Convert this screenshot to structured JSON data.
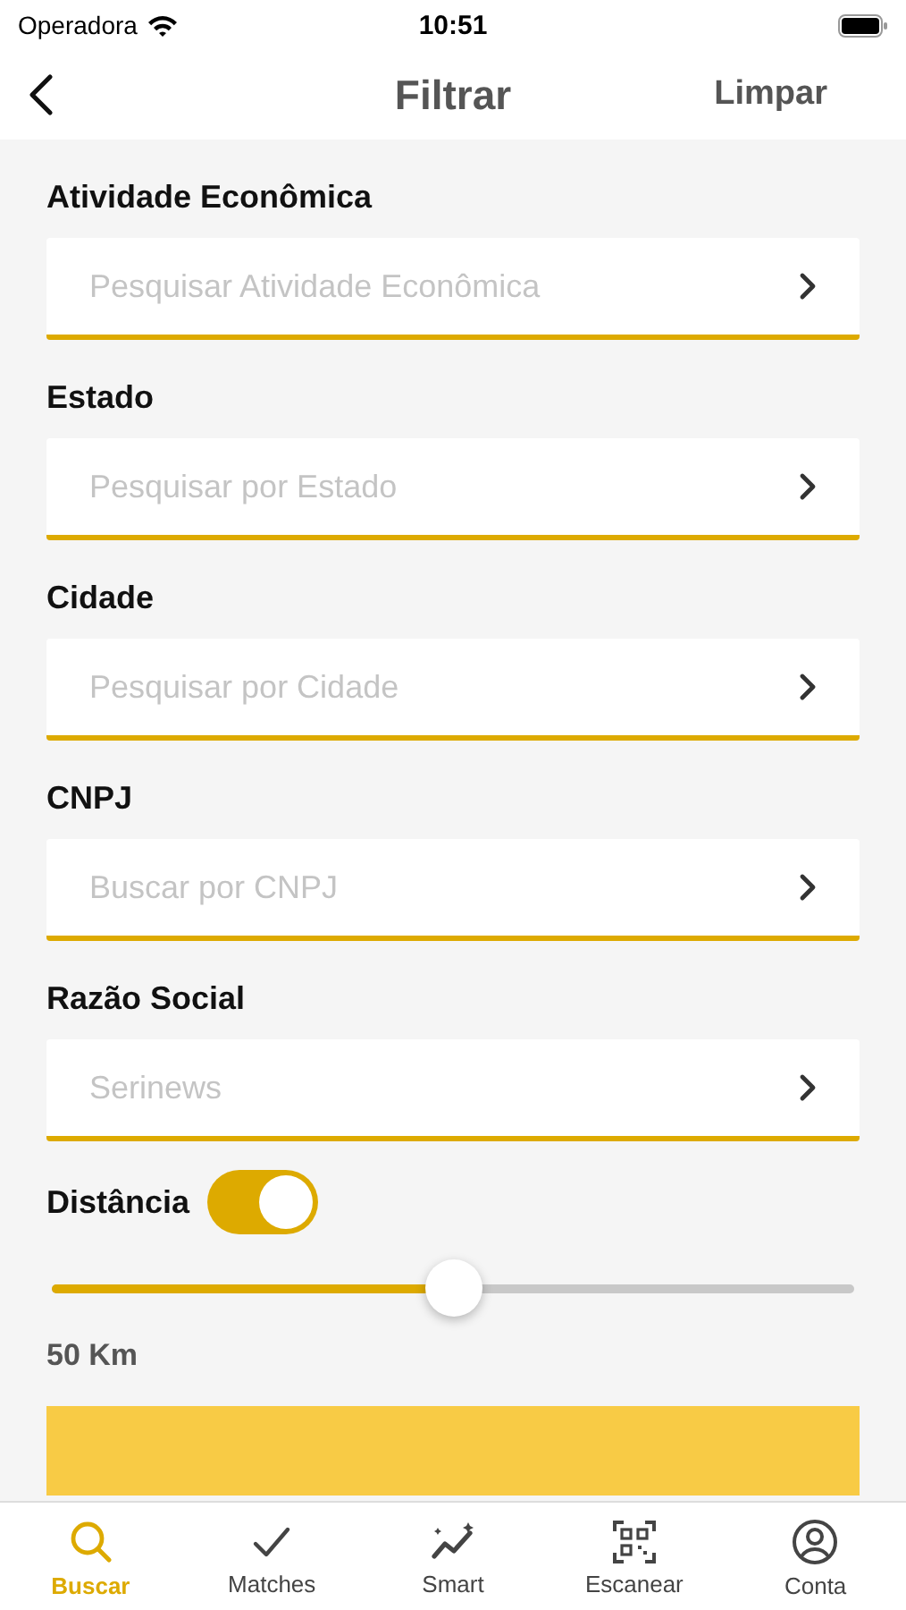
{
  "status_bar": {
    "carrier": "Operadora",
    "time": "10:51"
  },
  "nav": {
    "title": "Filtrar",
    "action": "Limpar"
  },
  "fields": [
    {
      "label": "Atividade Econômica",
      "placeholder": "Pesquisar Atividade Econômica"
    },
    {
      "label": "Estado",
      "placeholder": "Pesquisar por Estado"
    },
    {
      "label": "Cidade",
      "placeholder": "Pesquisar por Cidade"
    },
    {
      "label": "CNPJ",
      "placeholder": "Buscar por CNPJ"
    },
    {
      "label": "Razão Social",
      "placeholder": "Serinews"
    }
  ],
  "distance": {
    "label": "Distância",
    "on": true,
    "level": 0.5,
    "reading": "50 Km"
  },
  "tabs": [
    {
      "label": "Buscar",
      "kind": "search",
      "selected": true
    },
    {
      "label": "Matches",
      "kind": "check",
      "selected": false
    },
    {
      "label": "Smart",
      "kind": "smart",
      "selected": false
    },
    {
      "label": "Escanear",
      "kind": "scan",
      "selected": false
    },
    {
      "label": "Conta",
      "kind": "account",
      "selected": false
    }
  ]
}
